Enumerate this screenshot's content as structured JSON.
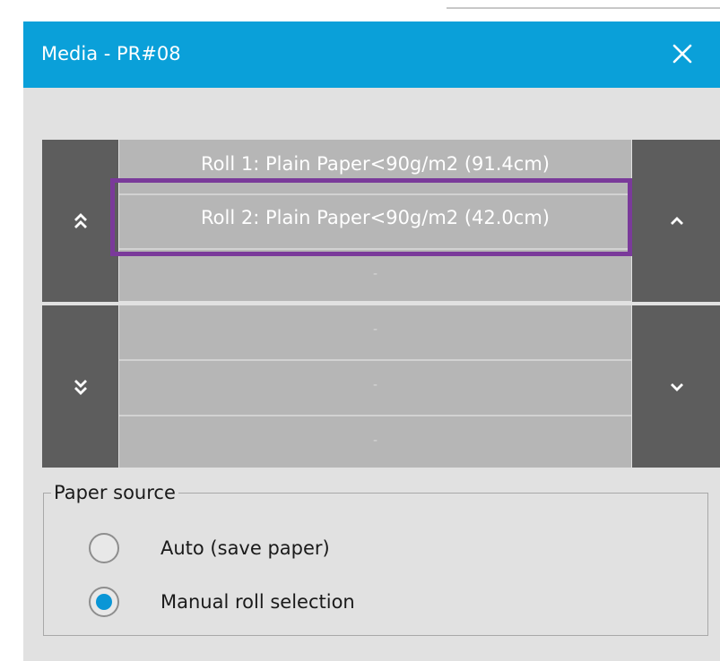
{
  "dialog": {
    "title": "Media - PR#08",
    "close_icon": "close-icon"
  },
  "media_list": {
    "rolls": [
      {
        "label": "Roll 1: Plain Paper<90g/m2 (91.4cm)",
        "selected": false
      },
      {
        "label": "Roll 2: Plain Paper<90g/m2 (42.0cm)",
        "selected": true
      },
      {
        "label": "-",
        "selected": false
      },
      {
        "label": "-",
        "selected": false
      },
      {
        "label": "-",
        "selected": false
      },
      {
        "label": "-",
        "selected": false
      }
    ],
    "highlight_color": "#7a3a9a"
  },
  "paper_source": {
    "legend": "Paper source",
    "options": [
      {
        "label": "Auto (save paper)",
        "checked": false
      },
      {
        "label": "Manual roll selection",
        "checked": true
      }
    ]
  },
  "colors": {
    "title_bar": "#0aa0d9",
    "dialog_bg": "#e1e1e1",
    "roll_bg": "#b6b6b6",
    "scroll_bg": "#5d5d5d",
    "radio_accent": "#0a96d6"
  }
}
